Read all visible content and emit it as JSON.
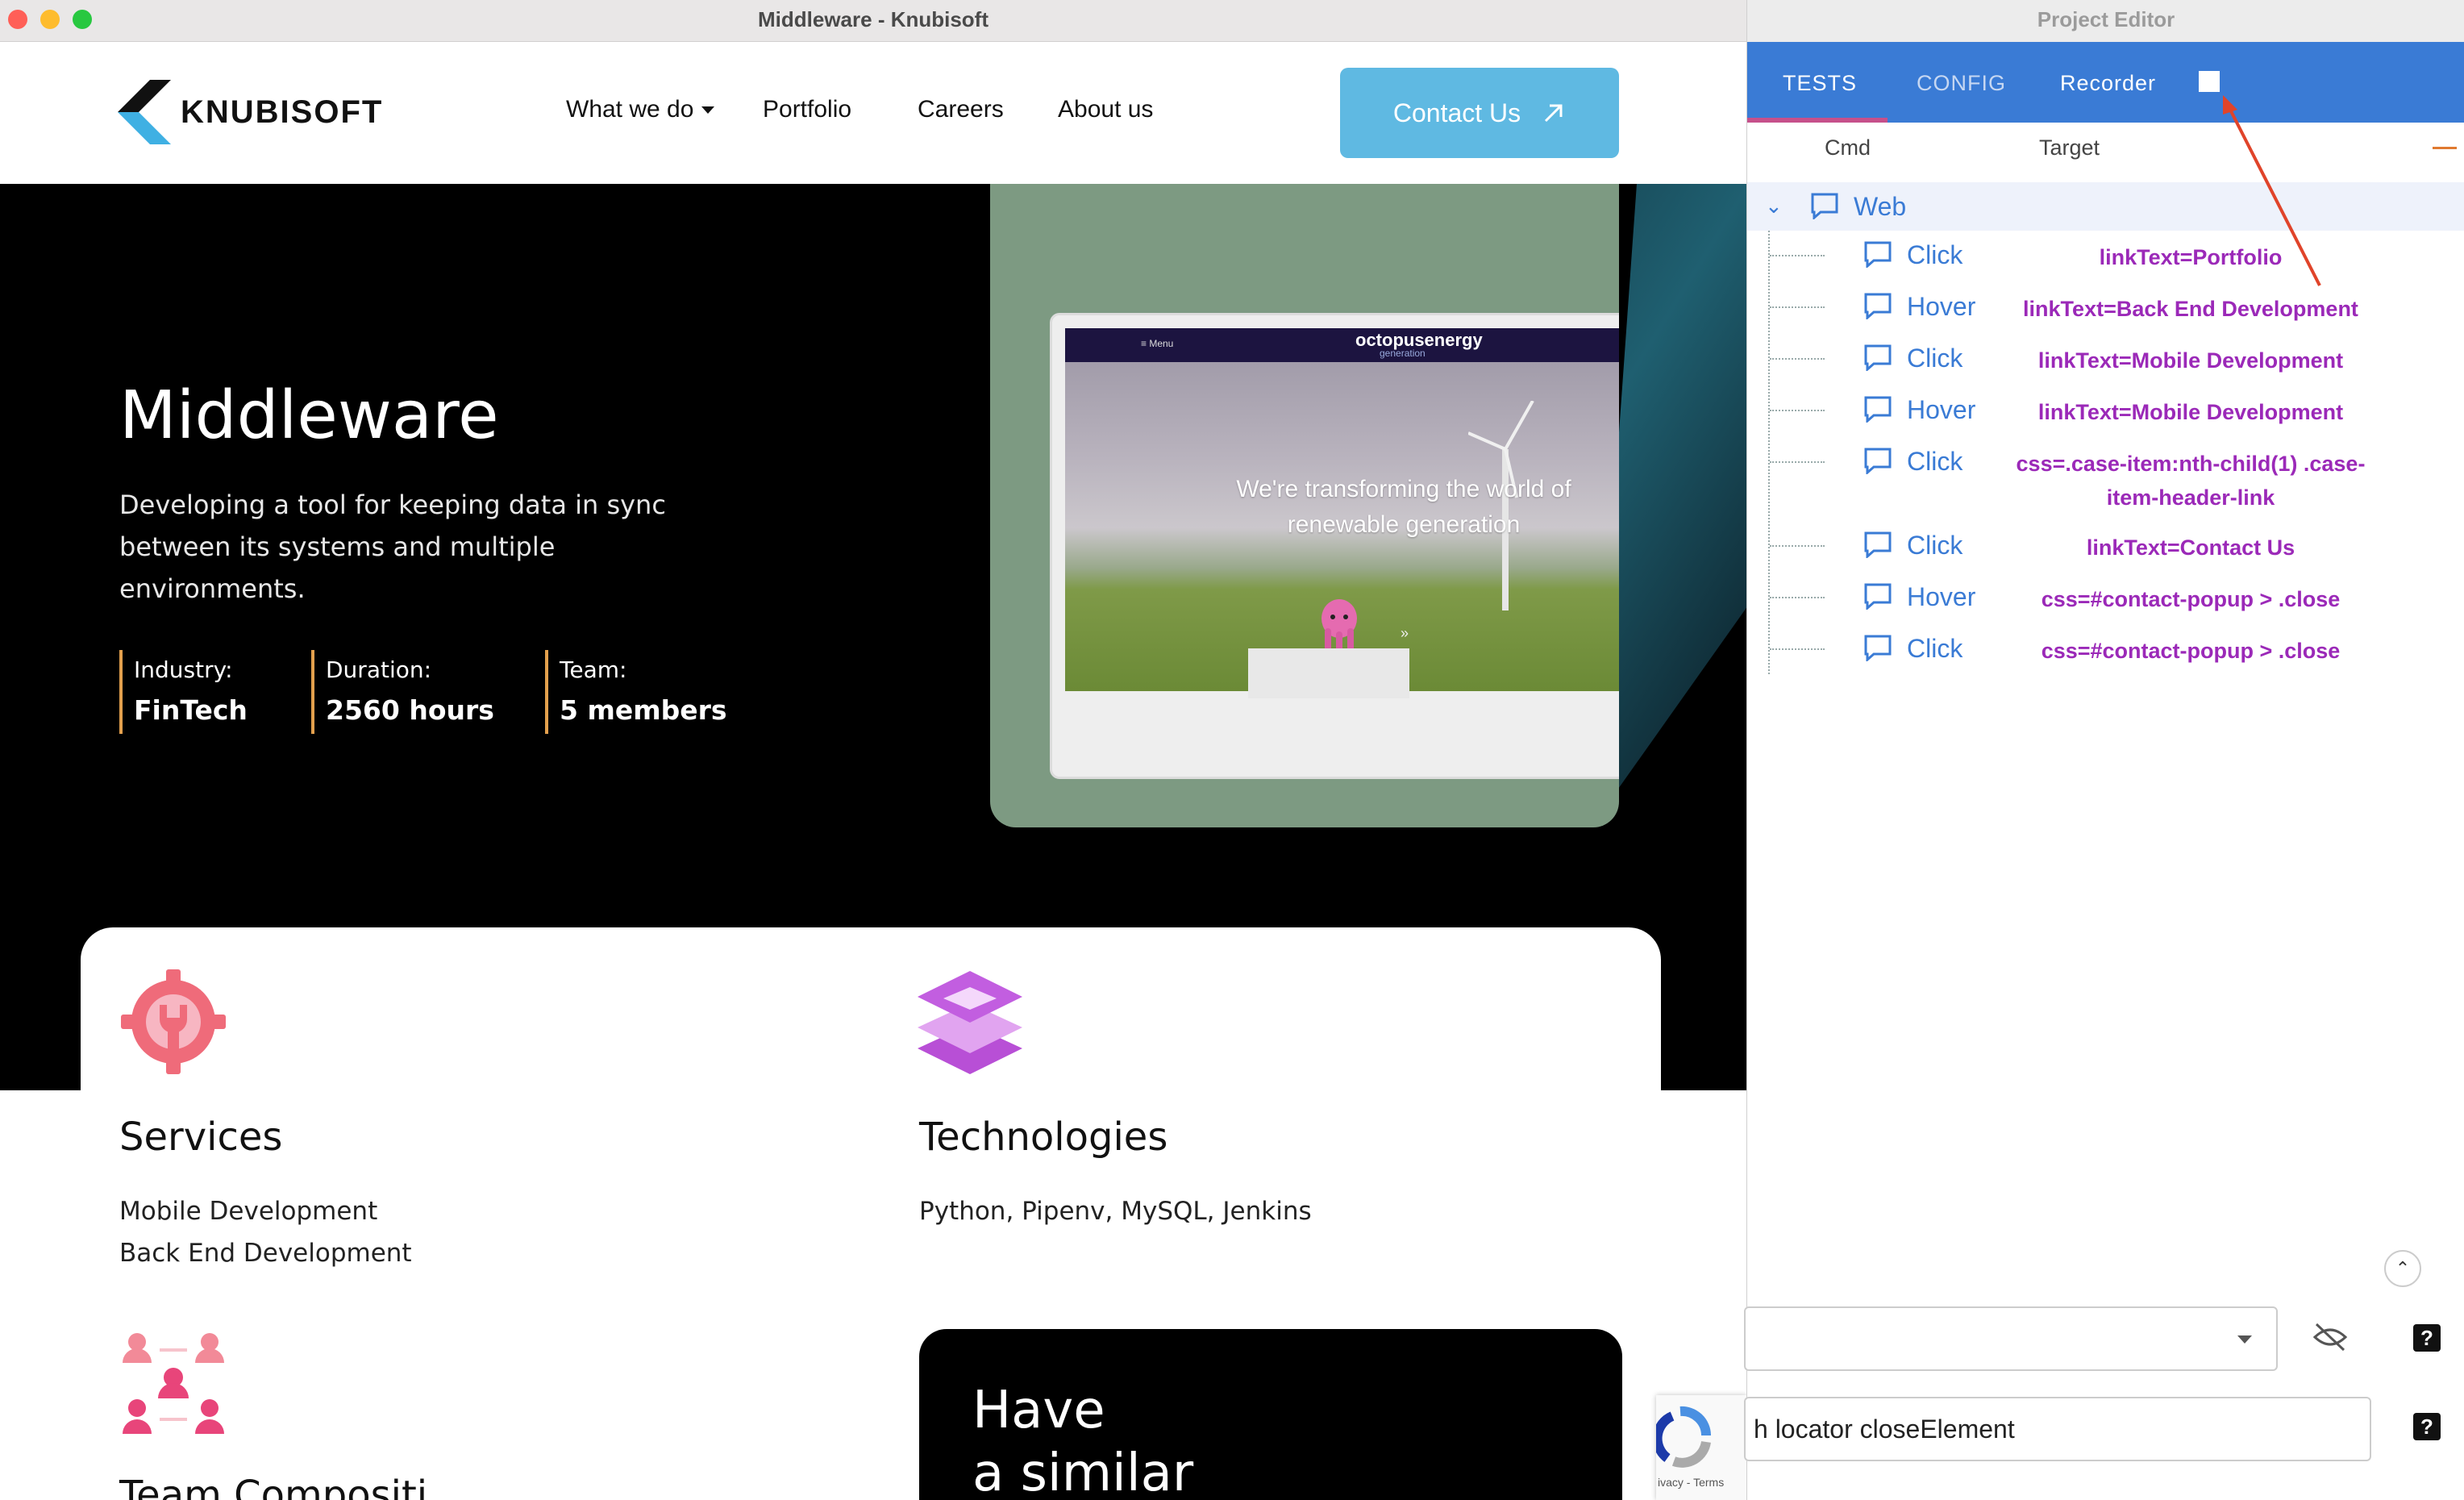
{
  "browser": {
    "window_title": "Middleware - Knubisoft"
  },
  "header": {
    "logo_text": "KNUBISOFT",
    "nav": [
      {
        "label": "What we do",
        "has_dropdown": true
      },
      {
        "label": "Portfolio"
      },
      {
        "label": "Careers"
      },
      {
        "label": "About us"
      }
    ],
    "contact_label": "Contact Us"
  },
  "hero": {
    "title": "Middleware",
    "description": "Developing a tool for keeping data in sync between its systems and multiple environments.",
    "stats": [
      {
        "label": "Industry:",
        "value": "FinTech"
      },
      {
        "label": "Duration:",
        "value": "2560 hours"
      },
      {
        "label": "Team:",
        "value": "5 members"
      }
    ],
    "screen": {
      "menu": "≡ Menu",
      "brand": "octopusenergy",
      "brand_sub": "generation",
      "headline": "We're transforming the world of renewable generation"
    }
  },
  "sections": {
    "services": {
      "title": "Services",
      "items": [
        "Mobile Development",
        "Back End Development"
      ]
    },
    "technologies": {
      "title": "Technologies",
      "text": "Python, Pipenv, MySQL, Jenkins"
    },
    "team_title_clipped": "Team Compositi",
    "cta": {
      "line1": "Have",
      "line2": "a similar"
    }
  },
  "recaptcha": {
    "text": "ivacy - Terms"
  },
  "editor": {
    "window_title": "Project Editor",
    "tabs": {
      "tests": "TESTS",
      "config": "CONFIG",
      "recorder": "Recorder"
    },
    "columns": {
      "cmd": "Cmd",
      "target": "Target"
    },
    "group": "Web",
    "steps": [
      {
        "cmd": "Click",
        "target": "linkText=Portfolio"
      },
      {
        "cmd": "Hover",
        "target": "linkText=Back End Development"
      },
      {
        "cmd": "Click",
        "target": "linkText=Mobile Development"
      },
      {
        "cmd": "Hover",
        "target": "linkText=Mobile Development"
      },
      {
        "cmd": "Click",
        "target": "css=.case-item:nth-child(1) .case-item-header-link"
      },
      {
        "cmd": "Click",
        "target": "linkText=Contact Us"
      },
      {
        "cmd": "Hover",
        "target": "css=#contact-popup > .close"
      },
      {
        "cmd": "Click",
        "target": "css=#contact-popup > .close"
      }
    ],
    "select_value": "",
    "input_value": "h locator closeElement",
    "help": "?",
    "colors": {
      "accent": "#3a7bd5",
      "target": "#9b29b8",
      "annotation_arrow": "#e0442a"
    }
  }
}
